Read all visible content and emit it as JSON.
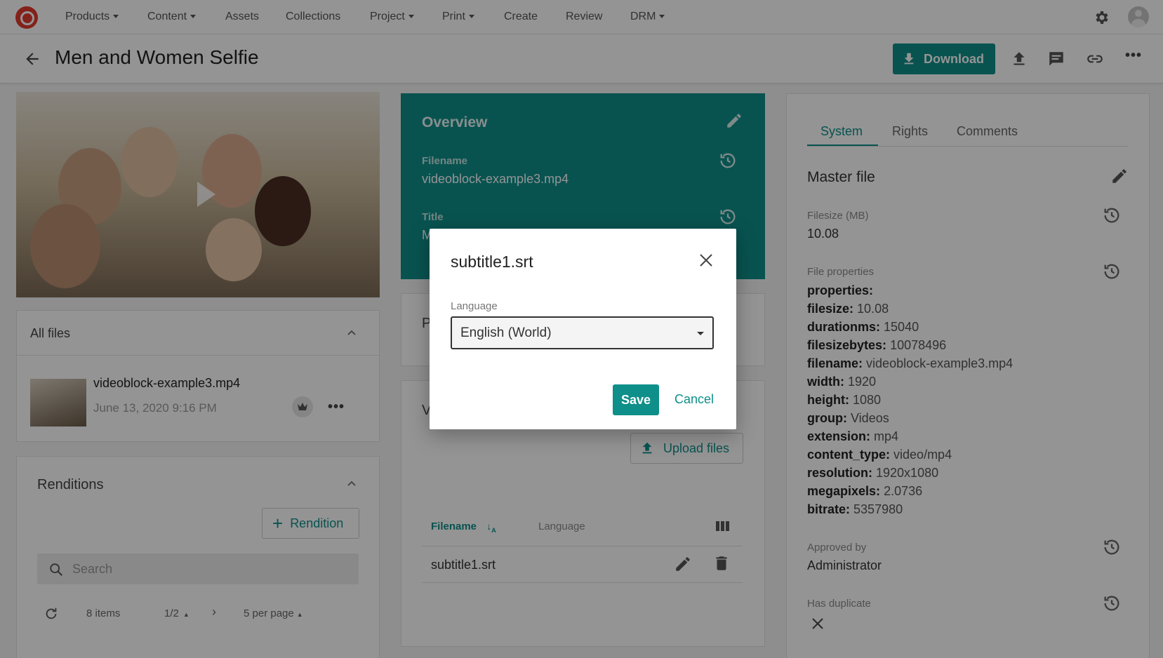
{
  "nav": {
    "items": [
      {
        "label": "Products",
        "dropdown": true
      },
      {
        "label": "Content",
        "dropdown": true
      },
      {
        "label": "Assets",
        "dropdown": false
      },
      {
        "label": "Collections",
        "dropdown": false
      },
      {
        "label": "Project",
        "dropdown": true
      },
      {
        "label": "Print",
        "dropdown": true
      },
      {
        "label": "Create",
        "dropdown": false
      },
      {
        "label": "Review",
        "dropdown": false
      },
      {
        "label": "DRM",
        "dropdown": true
      }
    ]
  },
  "header": {
    "title": "Men and Women Selfie",
    "download_label": "Download"
  },
  "left": {
    "all_files_label": "All files",
    "file": {
      "name": "videoblock-example3.mp4",
      "date": "June 13, 2020 9:16 PM"
    },
    "renditions_label": "Renditions",
    "rendition_button": "Rendition",
    "search_placeholder": "Search",
    "pager": {
      "items": "8 items",
      "page": "1/2",
      "per_page": "5 per page"
    }
  },
  "overview": {
    "title": "Overview",
    "filename_label": "Filename",
    "filename_value": "videoblock-example3.mp4",
    "title_label": "Title",
    "title_value_partial": "M"
  },
  "middle": {
    "section2_partial": "P",
    "section3_partial": "V",
    "upload_label": "Upload files",
    "columns": {
      "filename": "Filename",
      "language": "Language"
    },
    "rows": [
      {
        "filename": "subtitle1.srt"
      }
    ]
  },
  "right": {
    "tabs": [
      "System",
      "Rights",
      "Comments"
    ],
    "active_tab": "System",
    "master_file": "Master file",
    "filesize_label": "Filesize (MB)",
    "filesize_value": "10.08",
    "file_props_label": "File properties",
    "properties": [
      {
        "key": "properties:",
        "value": ""
      },
      {
        "key": "filesize:",
        "value": "10.08"
      },
      {
        "key": "durationms:",
        "value": "15040"
      },
      {
        "key": "filesizebytes:",
        "value": "10078496"
      },
      {
        "key": "filename:",
        "value": "videoblock-example3.mp4"
      },
      {
        "key": "width:",
        "value": "1920"
      },
      {
        "key": "height:",
        "value": "1080"
      },
      {
        "key": "group:",
        "value": "Videos"
      },
      {
        "key": "extension:",
        "value": "mp4"
      },
      {
        "key": "content_type:",
        "value": "video/mp4"
      },
      {
        "key": "resolution:",
        "value": "1920x1080"
      },
      {
        "key": "megapixels:",
        "value": "2.0736"
      },
      {
        "key": "bitrate:",
        "value": "5357980"
      }
    ],
    "approved_label": "Approved by",
    "approved_value": "Administrator",
    "duplicate_label": "Has duplicate"
  },
  "modal": {
    "title": "subtitle1.srt",
    "language_label": "Language",
    "language_value": "English (World)",
    "save_label": "Save",
    "cancel_label": "Cancel"
  },
  "colors": {
    "accent": "#0e8f8a",
    "brand": "#e23a2e"
  }
}
